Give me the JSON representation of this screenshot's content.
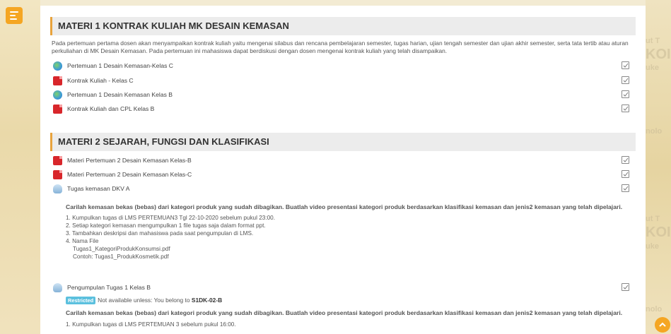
{
  "drawer_icon": "hamburger-menu-icon",
  "back_to_top_icon": "chevron-up-icon",
  "watermark": {
    "lines": [
      "ut T",
      "KOI",
      "uke",
      "nolo",
      "ut T",
      "KOI",
      "uke",
      "nolo"
    ]
  },
  "section1": {
    "title": "MATERI 1 KONTRAK KULIAH MK DESAIN KEMASAN",
    "description": "Pada pertemuan pertama dosen akan menyampaikan kontrak kuliah yaitu mengenai silabus dan rencana pembelajaran semester, tugas harian, ujian tengah semester dan ujian akhir semester, serta tata tertib atau aturan perkuliahan di MK Desain Kemasan. Pada pertemuan ini mahasiswa dapat berdiskusi dengan dosen mengenai kontrak kuliah yang telah disampaikan.",
    "items": [
      {
        "label": "Pertemuan 1 Desain Kemasan-Kelas C",
        "icon": "url-globe-icon"
      },
      {
        "label": "Kontrak Kuliah - Kelas C",
        "icon": "pdf-file-icon"
      },
      {
        "label": "Pertemuan 1 Desain Kemasan Kelas B",
        "icon": "url-globe-icon"
      },
      {
        "label": "Kontrak Kuliah dan CPL Kelas B",
        "icon": "pdf-file-icon"
      }
    ]
  },
  "section2": {
    "title": "MATERI 2 SEJARAH, FUNGSI DAN KLASIFIKASI",
    "items": [
      {
        "label": "Materi Pertemuan 2 Desain Kemasan Kelas-B",
        "icon": "pdf-file-icon"
      },
      {
        "label": "Materi Pertemuan 2 Desain Kemasan Kelas-C",
        "icon": "pdf-file-icon"
      },
      {
        "label": "Tugas kemasan DKV A",
        "icon": "assignment-icon"
      }
    ],
    "assignment_intro": "Carilah kemasan bekas (bebas) dari kategori produk yang sudah dibagikan. Buatlah video presentasi kategori produk berdasarkan klasifikasi kemasan dan jenis2 kemasan yang telah dipelajari.",
    "assignment_steps": [
      "1. Kumpulkan tugas di LMS PERTEMUAN3 Tgl 22-10-2020 sebelum pukul 23:00.",
      "2. Setiap kategori kemasan mengumpulkan 1 file tugas saja dalam format ppt.",
      "3. Tambahkan deskripsi dan mahasiswa pada saat pengumpulan di LMS.",
      "4. Nama File",
      "    Tugas1_KategoriProdukKonsumsi.pdf",
      "    Contoh: Tugas1_ProdukKosmetik.pdf"
    ],
    "item4": {
      "label": "Pengumpulan Tugas 1 Kelas B",
      "icon": "assignment-icon"
    },
    "restriction": {
      "badge": "Restricted",
      "text": "Not available unless: You belong to ",
      "group": "S1DK-02-B"
    },
    "assignment_intro_2": "Carilah kemasan bekas (bebas) dari kategori produk yang sudah dibagikan. Buatlah video presentasi kategori produk berdasarkan klasifikasi kemasan dan jenis2 kemasan yang telah dipelajari.",
    "assignment_steps_2": [
      "1. Kumpulkan tugas di LMS PERTEMUAN 3 sebelum pukul 16:00."
    ]
  }
}
